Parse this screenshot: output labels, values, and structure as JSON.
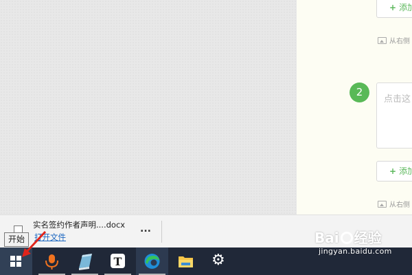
{
  "editor": {
    "add_button_label": "添加",
    "add_plus_symbol": "+",
    "image_link_label": "从右侧",
    "step_number": "2",
    "text_placeholder": "点击这"
  },
  "download_bar": {
    "file_name": "实名签约作者声明....docx",
    "open_file_label": "打开文件",
    "more_label": "..."
  },
  "taskbar": {
    "start_tooltip": "开始",
    "items": [
      {
        "name": "start-button",
        "icon": "windows-logo-icon"
      },
      {
        "name": "voice-recorder-app",
        "icon": "microphone-icon"
      },
      {
        "name": "notebook-app",
        "icon": "notebook-icon"
      },
      {
        "name": "typora-app",
        "icon": "t-letter-icon",
        "glyph": "T"
      },
      {
        "name": "edge-browser",
        "icon": "edge-icon"
      },
      {
        "name": "file-explorer",
        "icon": "folder-icon"
      },
      {
        "name": "settings",
        "icon": "gear-icon",
        "glyph": "⚙"
      }
    ]
  },
  "watermark": {
    "title_left": "Bai",
    "title_right": "经验",
    "url": "jingyan.baidu.com"
  },
  "colors": {
    "accent_green": "#59b957",
    "link_blue": "#1a66c0",
    "taskbar_bg": "#202838",
    "arrow_red": "#e0241b"
  }
}
